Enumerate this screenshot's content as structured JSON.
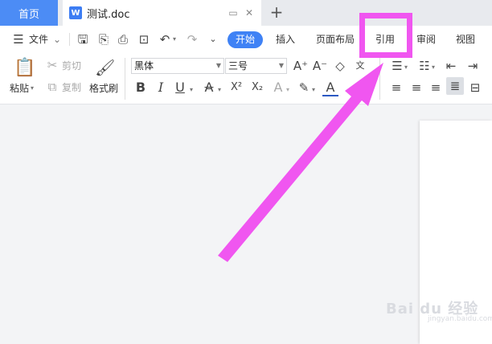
{
  "tabbar": {
    "home_label": "首页",
    "doc_icon_letter": "W",
    "doc_title": "测试.doc",
    "add_label": "+"
  },
  "menubar": {
    "file_label": "文件",
    "tabs": [
      {
        "label": "开始",
        "active": true
      },
      {
        "label": "插入"
      },
      {
        "label": "页面布局"
      },
      {
        "label": "引用",
        "highlighted": true
      },
      {
        "label": "审阅"
      },
      {
        "label": "视图"
      }
    ]
  },
  "ribbon": {
    "paste_label": "粘贴",
    "cut_label": "剪切",
    "copy_label": "复制",
    "format_painter_label": "格式刷",
    "font_name": "黑体",
    "font_size": "三号",
    "bold": "B",
    "italic": "I",
    "underline": "U",
    "strikethrough": "A",
    "superscript": "X²",
    "subscript": "X₂",
    "grow_font": "A⁺",
    "shrink_font": "A⁻",
    "font_color": "A"
  },
  "watermark": {
    "text": "Bai du 经验",
    "sub": "jingyan.baidu.com"
  },
  "colors": {
    "accent": "#3f82f5",
    "annotation": "#f056f0"
  }
}
